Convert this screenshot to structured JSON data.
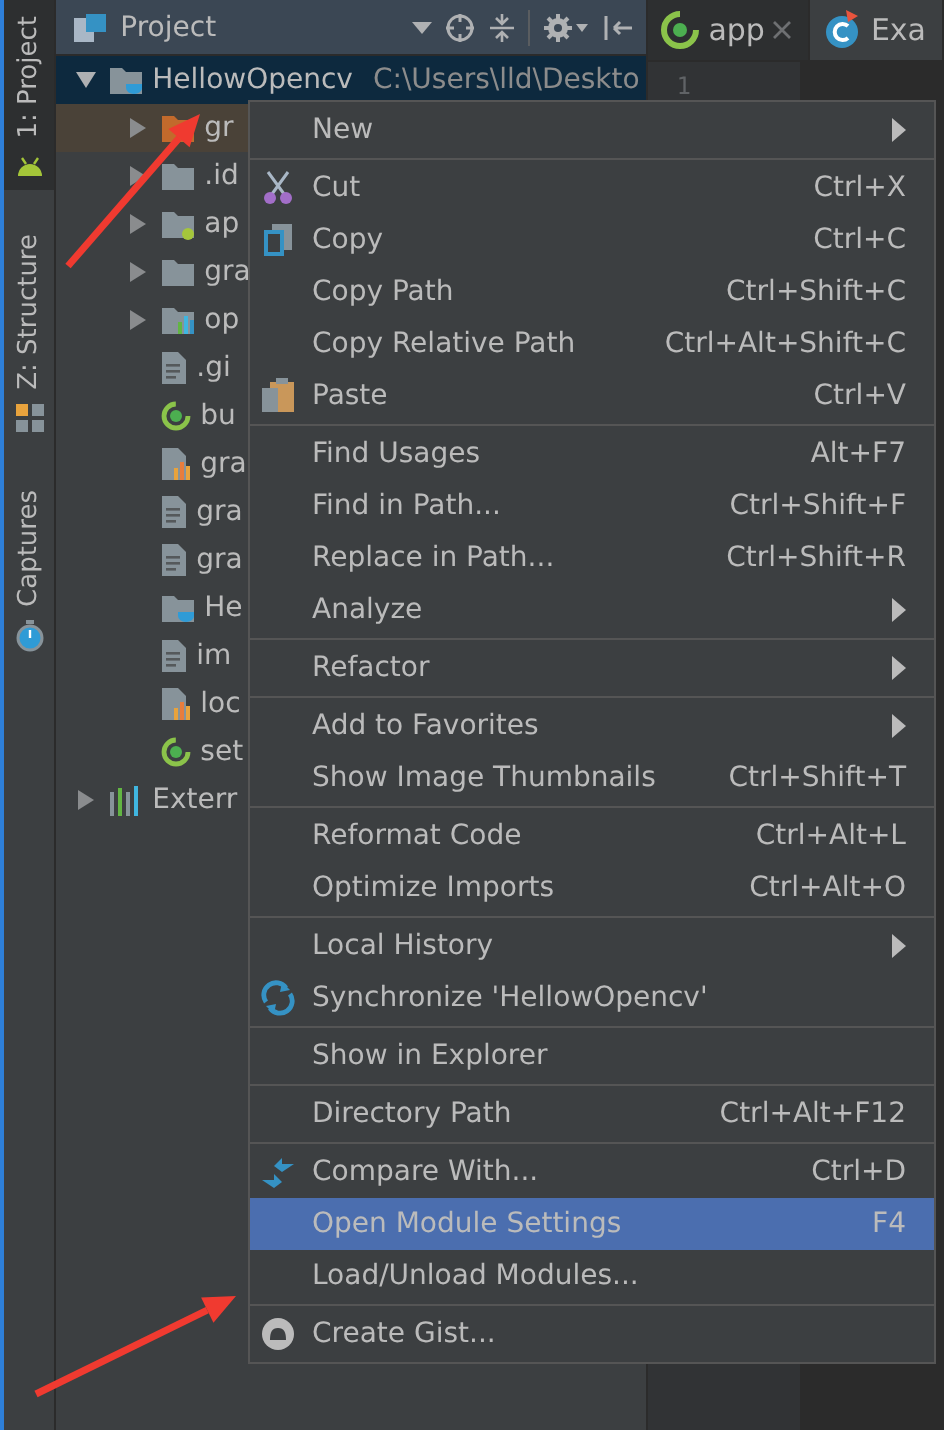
{
  "tool_strip": [
    {
      "label": "1: Project",
      "selected": true
    },
    {
      "label": "Z: Structure",
      "selected": false
    },
    {
      "label": "Captures",
      "selected": false
    }
  ],
  "project_panel": {
    "title": "Project",
    "tree": [
      {
        "label": "HellowOpencv",
        "path": "C:\\Users\\lld\\Deskto",
        "kind": "project",
        "expanded": true,
        "selected": true,
        "excluded": false,
        "children": [
          {
            "label": "gr",
            "kind": "folder",
            "expanded": false,
            "selected": false,
            "excluded": true
          },
          {
            "label": ".id",
            "kind": "folder",
            "expanded": false,
            "selected": false,
            "excluded": false
          },
          {
            "label": "ap",
            "kind": "module",
            "expanded": false,
            "selected": false,
            "excluded": false
          },
          {
            "label": "gra",
            "kind": "folder",
            "expanded": false,
            "selected": false,
            "excluded": false
          },
          {
            "label": "op",
            "kind": "library",
            "expanded": false,
            "selected": false,
            "excluded": false
          },
          {
            "label": ".gi",
            "kind": "text",
            "selected": false,
            "excluded": false
          },
          {
            "label": "bu",
            "kind": "gradle",
            "selected": false,
            "excluded": false
          },
          {
            "label": "gra",
            "kind": "properties",
            "selected": false,
            "excluded": false
          },
          {
            "label": "gra",
            "kind": "text",
            "selected": false,
            "excluded": false
          },
          {
            "label": "gra",
            "kind": "text",
            "selected": false,
            "excluded": false
          },
          {
            "label": "He",
            "kind": "project",
            "selected": false,
            "excluded": false
          },
          {
            "label": "im",
            "kind": "text",
            "selected": false,
            "excluded": false
          },
          {
            "label": "loc",
            "kind": "properties",
            "selected": false,
            "excluded": false
          },
          {
            "label": "set",
            "kind": "gradle",
            "selected": false,
            "excluded": false
          }
        ]
      },
      {
        "label": "Exterr",
        "kind": "libraries",
        "expanded": false,
        "selected": false,
        "excluded": false
      }
    ]
  },
  "editor": {
    "tabs": [
      {
        "label": "app",
        "selected": true,
        "closable": true
      },
      {
        "label": "Exa",
        "selected": false,
        "closable": false
      }
    ],
    "line_numbers": [
      "1"
    ]
  },
  "context_menu": [
    [
      {
        "label": "New",
        "submenu": true,
        "selected": false
      }
    ],
    [
      {
        "label": "Cut",
        "shortcut": "Ctrl+X",
        "submenu": false,
        "selected": false
      },
      {
        "label": "Copy",
        "shortcut": "Ctrl+C",
        "submenu": false,
        "selected": false
      },
      {
        "label": "Copy Path",
        "shortcut": "Ctrl+Shift+C",
        "submenu": false,
        "selected": false
      },
      {
        "label": "Copy Relative Path",
        "shortcut": "Ctrl+Alt+Shift+C",
        "submenu": false,
        "selected": false
      },
      {
        "label": "Paste",
        "shortcut": "Ctrl+V",
        "submenu": false,
        "selected": false
      }
    ],
    [
      {
        "label": "Find Usages",
        "shortcut": "Alt+F7",
        "submenu": false,
        "selected": false
      },
      {
        "label": "Find in Path...",
        "shortcut": "Ctrl+Shift+F",
        "submenu": false,
        "selected": false
      },
      {
        "label": "Replace in Path...",
        "shortcut": "Ctrl+Shift+R",
        "submenu": false,
        "selected": false
      },
      {
        "label": "Analyze",
        "submenu": true,
        "selected": false
      }
    ],
    [
      {
        "label": "Refactor",
        "submenu": true,
        "selected": false
      }
    ],
    [
      {
        "label": "Add to Favorites",
        "submenu": true,
        "selected": false
      },
      {
        "label": "Show Image Thumbnails",
        "shortcut": "Ctrl+Shift+T",
        "submenu": false,
        "selected": false
      }
    ],
    [
      {
        "label": "Reformat Code",
        "shortcut": "Ctrl+Alt+L",
        "submenu": false,
        "selected": false
      },
      {
        "label": "Optimize Imports",
        "shortcut": "Ctrl+Alt+O",
        "submenu": false,
        "selected": false
      }
    ],
    [
      {
        "label": "Local History",
        "submenu": true,
        "selected": false
      },
      {
        "label": "Synchronize 'HellowOpencv'",
        "submenu": false,
        "selected": false
      }
    ],
    [
      {
        "label": "Show in Explorer",
        "submenu": false,
        "selected": false
      }
    ],
    [
      {
        "label": "Directory Path",
        "shortcut": "Ctrl+Alt+F12",
        "submenu": false,
        "selected": false
      }
    ],
    [
      {
        "label": "Compare With...",
        "shortcut": "Ctrl+D",
        "submenu": false,
        "selected": false
      },
      {
        "label": "Open Module Settings",
        "shortcut": "F4",
        "submenu": false,
        "selected": true
      },
      {
        "label": "Load/Unload Modules...",
        "submenu": false,
        "selected": false
      }
    ],
    [
      {
        "label": "Create Gist...",
        "submenu": false,
        "selected": false
      }
    ]
  ]
}
